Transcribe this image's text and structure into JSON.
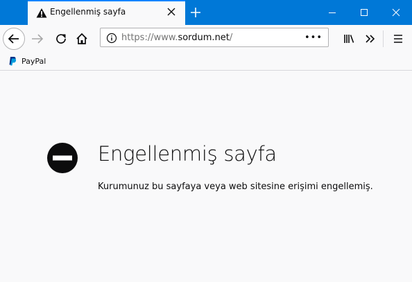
{
  "tab": {
    "title": "Engellenmiş sayfa"
  },
  "urlbar": {
    "scheme": "https://www.",
    "host": "sordum.net",
    "path": "/",
    "more": "•••"
  },
  "bookmarks": [
    {
      "label": "PayPal",
      "icon": "paypal-icon"
    }
  ],
  "error": {
    "title": "Engellenmiş sayfa",
    "description": "Kurumunuz bu sayfaya veya web sitesine erişimi engellemiş."
  },
  "colors": {
    "titlebar": "#0078d7",
    "tab_accent": "#0a84ff",
    "page_bg": "#f9f9fa"
  }
}
